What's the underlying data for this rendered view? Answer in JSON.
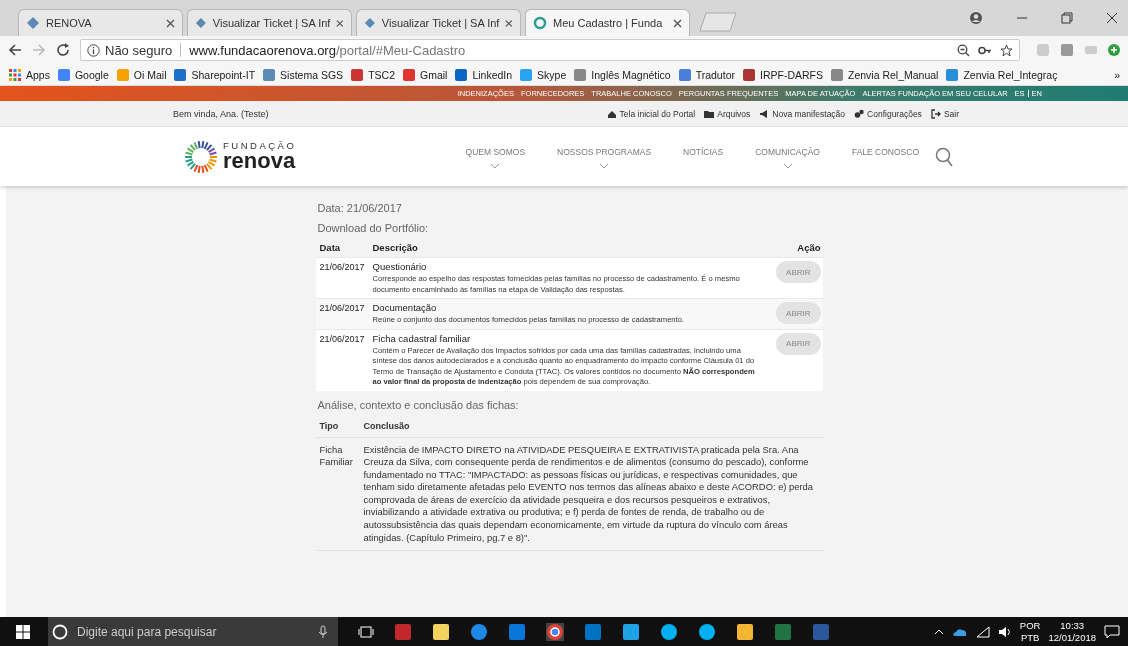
{
  "browser": {
    "tabs": [
      {
        "title": "RENOVA",
        "selected": false
      },
      {
        "title": "Visualizar Ticket | SA Inf",
        "selected": false
      },
      {
        "title": "Visualizar Ticket | SA Inf",
        "selected": false
      },
      {
        "title": "Meu Cadastro | Funda",
        "selected": true
      }
    ],
    "address": {
      "security": "Não seguro",
      "host": "www.fundacaorenova.org",
      "path": "/portal/#Meu-Cadastro"
    },
    "bookmarks": [
      "Apps",
      "Google",
      "Oi Mail",
      "Sharepoint-IT",
      "Sistema SGS",
      "TSC2",
      "Gmail",
      "LinkedIn",
      "Skype",
      "Inglês Magnético",
      "Tradutor",
      "IRPF-DARFS",
      "Zenvia Rel_Manual",
      "Zenvia Rel_Integraç"
    ],
    "bookmarks_overflow": "»"
  },
  "site": {
    "top_links": [
      "INDENIZAÇÕES",
      "FORNECEDORES",
      "TRABALHE CONOSCO",
      "PERGUNTAS FREQUENTES",
      "MAPA DE ATUAÇÃO",
      "ALERTAS FUNDAÇÃO EM SEU CELULAR"
    ],
    "languages": [
      "ES",
      "EN"
    ],
    "welcome": "Bem vinda, Ana. (Teste)",
    "user_links": [
      "Tela inicial do Portal",
      "Arquivos",
      "Nova manifestação",
      "Configurações",
      "Sair"
    ],
    "logo": {
      "top": "FUNDAÇÃO",
      "main": "renova"
    },
    "nav": [
      {
        "label": "QUEM SOMOS",
        "dropdown": true
      },
      {
        "label": "NOSSOS PROGRAMAS",
        "dropdown": true
      },
      {
        "label": "NOTÍCIAS",
        "dropdown": false
      },
      {
        "label": "COMUNICAÇÃO",
        "dropdown": true
      },
      {
        "label": "FALE CONOSCO",
        "dropdown": false
      }
    ]
  },
  "content": {
    "date": "Data: 21/06/2017",
    "portfolio_label": "Download do Portfólio:",
    "portfolio_table": {
      "columns": [
        "Data",
        "Descrição",
        "Ação"
      ],
      "rows": [
        {
          "date": "21/06/2017",
          "title": "Questionário",
          "description": "Corresponde ao espelho das respostas fornecidas pelas famílias no processo de cadastramento. É o mesmo documento encaminhado às famílias na etapa de Validação das respostas.",
          "action": "ABRIR"
        },
        {
          "date": "21/06/2017",
          "title": "Documentação",
          "description": "Reúne o conjunto dos documentos fornecidos pelas famílias no processo de cadastramento.",
          "action": "ABRIR"
        },
        {
          "date": "21/06/2017",
          "title": "Ficha cadastral familiar",
          "description": "Contém o Parecer de Avaliação dos Impactos sofridos por cada uma das famílias cadastradas, incluindo uma síntese dos danos autodeclarados e a conclusão quanto ao enquadramento do impacto conforme Cláusula 01 do Termo de Transação de Ajustamento e Conduta (TTAC). Os valores contidos no documento **NÃO correspondem ao valor final da proposta de indenização** pois dependem de sua comprovação.",
          "action": "ABRIR"
        }
      ]
    },
    "analysis_label": "Análise, contexto e conclusão das fichas:",
    "analysis_table": {
      "columns": [
        "Tipo",
        "Conclusão"
      ],
      "rows": [
        {
          "type": "Ficha Familiar",
          "conclusion": "Existência de IMPACTO DIRETO na ATIVIDADE PESQUEIRA E EXTRATIVISTA praticada pela Sra. Ana Creuza da Silva, com consequente perda de rendimentos e de alimentos (consumo do pescado), conforme fundamentado no TTAC: \"IMPACTADO: as pessoas físicas ou jurídicas, e respectivas comunidades, que tenham sido diretamente afetadas pelo EVENTO nos termos das alíneas abaixo e deste ACORDO: e) perda comprovada de áreas de exercício da atividade pesqueira e dos recursos pesqueiros e extrativos, inviabilizando a atividade extrativa ou produtiva; e f) perda de fontes de renda, de trabalho ou de autossubsistência das quais dependam economicamente, em virtude da ruptura do vínculo com áreas atingidas. (Capítulo Primeiro, pg.7 e 8)\"."
        }
      ]
    }
  },
  "taskbar": {
    "search_placeholder": "Digite aqui para pesquisar",
    "language": "POR",
    "layout": "PTB",
    "time": "10:33",
    "date": "12/01/2018"
  }
}
